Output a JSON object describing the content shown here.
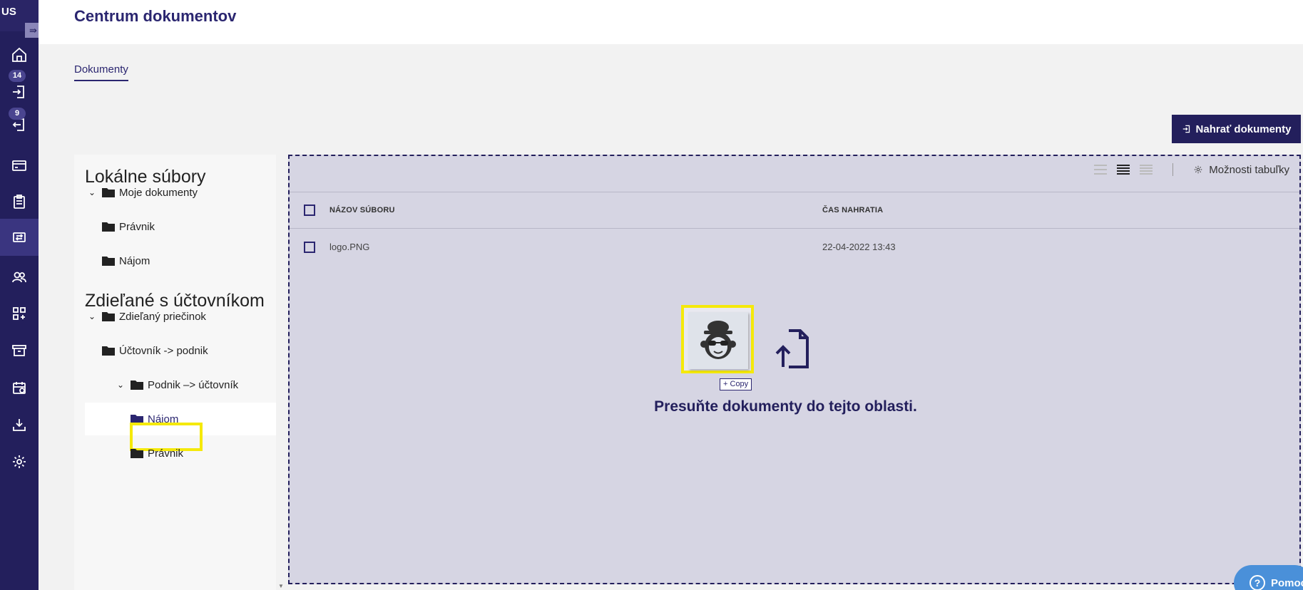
{
  "sidebar": {
    "logo": "US",
    "toggle_icon": "⇛",
    "items": [
      {
        "icon": "home-icon"
      },
      {
        "icon": "incoming-icon",
        "badge": "14"
      },
      {
        "icon": "outgoing-icon",
        "badge": "9"
      },
      {
        "icon": "card-icon"
      },
      {
        "icon": "clipboard-icon"
      },
      {
        "icon": "documents-exchange-icon",
        "active": true
      },
      {
        "icon": "users-icon"
      },
      {
        "icon": "apps-icon"
      },
      {
        "icon": "archive-icon"
      },
      {
        "icon": "calendar-icon"
      },
      {
        "icon": "download-icon"
      },
      {
        "icon": "settings-icon"
      }
    ]
  },
  "header": {
    "title": "Centrum dokumentov"
  },
  "tabs": [
    {
      "label": "Dokumenty",
      "active": true
    }
  ],
  "toolbar": {
    "upload_label": "Nahrať dokumenty"
  },
  "tree": {
    "local_heading": "Lokálne súbory",
    "shared_heading": "Zdieľané s účtovníkom",
    "local": [
      {
        "label": "Moje dokumenty",
        "expanded": true
      },
      {
        "label": "Právnik"
      },
      {
        "label": "Nájom"
      }
    ],
    "shared": [
      {
        "label": "Zdieľaný priečinok",
        "expanded": true
      },
      {
        "label": "Účtovník -> podnik"
      },
      {
        "label": "Podnik –> účtovník",
        "expanded": true
      },
      {
        "label": "Nájom",
        "selected": true
      },
      {
        "label": "Právnik"
      }
    ]
  },
  "table": {
    "options_label": "Možnosti tabuľky",
    "columns": [
      "NÁZOV SÚBORU",
      "ČAS NAHRATIA"
    ],
    "rows": [
      {
        "name": "logo.PNG",
        "uploaded": "22-04-2022 13:43"
      }
    ]
  },
  "dropzone": {
    "copy_label": "Copy",
    "message": "Presuňte dokumenty do tejto oblasti."
  },
  "help": {
    "label": "Pomoc"
  },
  "colors": {
    "brand": "#231f5c",
    "highlight": "#f5e90a",
    "dropzone_bg": "#d6d5e3",
    "help": "#4a90d9"
  }
}
